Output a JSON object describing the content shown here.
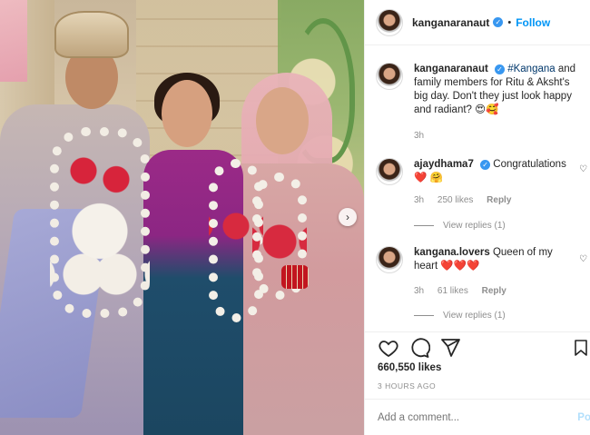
{
  "post": {
    "username": "kanganaranaut",
    "follow_label": "Follow",
    "dot": "•",
    "carousel_next": "›"
  },
  "caption": {
    "username": "kanganaranaut",
    "hashtag": "#Kangana",
    "text": " and family members for Ritu & Aksht's big day. Don't they just look happy and radiant? 😍🥰",
    "time": "3h"
  },
  "comments": [
    {
      "username": "ajaydhama7",
      "text": "Congratulations ❤️ 🤗",
      "time": "3h",
      "likes": "250 likes",
      "reply": "Reply",
      "view_replies": "View replies (1)"
    },
    {
      "username": "kangana.lovers",
      "text": "Queen of my heart ❤️❤️❤️",
      "time": "3h",
      "likes": "61 likes",
      "reply": "Reply",
      "view_replies": "View replies (1)"
    }
  ],
  "stats": {
    "likes": "660,550 likes",
    "time_ago": "3 HOURS AGO"
  },
  "add_comment": {
    "placeholder": "Add a comment...",
    "post_label": "Po"
  },
  "icons": {
    "verified": "✓",
    "heart_small": "♡"
  },
  "colors": {
    "accent": "#0095f6",
    "verified": "#3897f0",
    "hashtag": "#00376b",
    "muted": "#8e8e8e"
  }
}
